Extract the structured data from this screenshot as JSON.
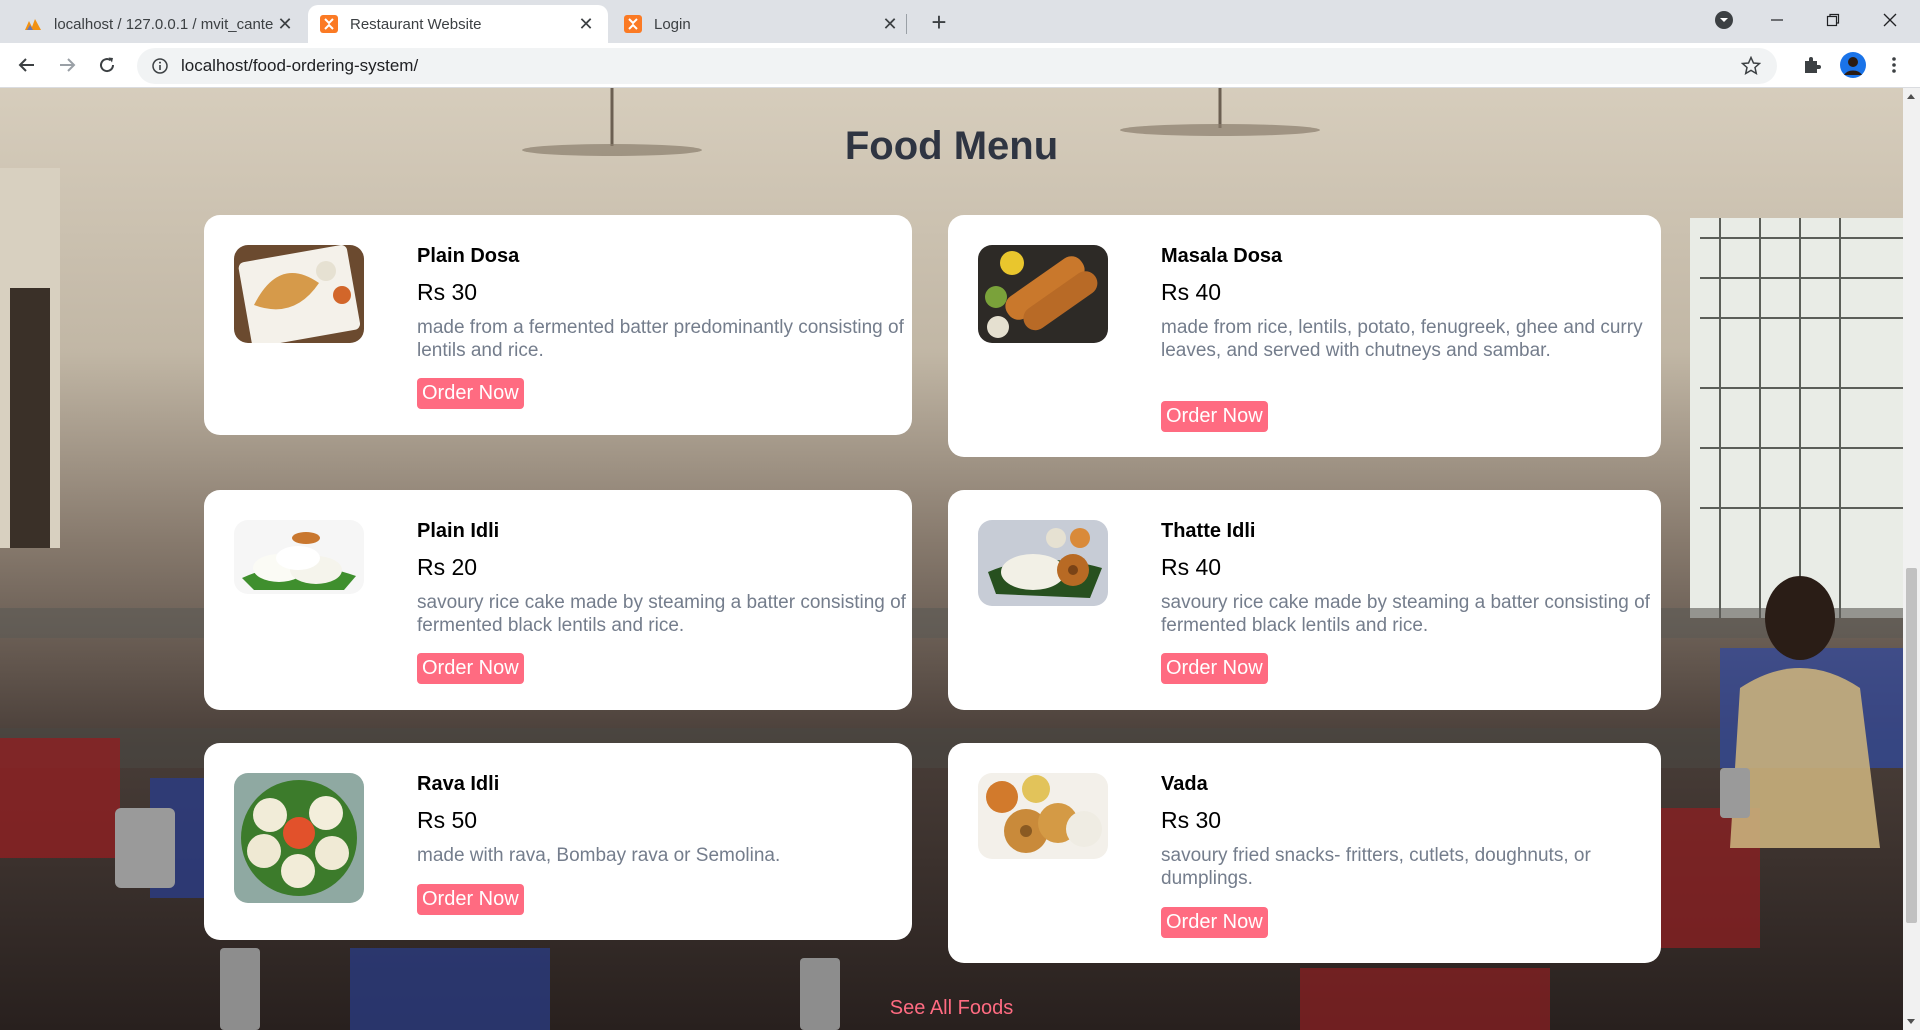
{
  "browser": {
    "tabs": [
      {
        "title": "localhost / 127.0.0.1 / mvit_cante",
        "favicon": "phpmyadmin-icon",
        "active": false
      },
      {
        "title": "Restaurant Website",
        "favicon": "xampp-icon",
        "active": true
      },
      {
        "title": "Login",
        "favicon": "xampp-icon",
        "active": false
      }
    ],
    "url": "localhost/food-ordering-system/"
  },
  "page": {
    "title": "Food Menu",
    "order_label": "Order Now",
    "see_all": "See All Foods",
    "foods": [
      {
        "name": "Plain Dosa",
        "price": "Rs 30",
        "description": "made from a fermented batter predominantly consisting of lentils and rice."
      },
      {
        "name": "Masala Dosa",
        "price": "Rs 40",
        "description": "made from rice, lentils, potato, fenugreek, ghee and curry leaves, and served with chutneys and sambar."
      },
      {
        "name": "Plain Idli",
        "price": "Rs 20",
        "description": "savoury rice cake made by steaming a batter consisting of fermented black lentils and rice."
      },
      {
        "name": "Thatte Idli",
        "price": "Rs 40",
        "description": "savoury rice cake made by steaming a batter consisting of fermented black lentils and rice."
      },
      {
        "name": "Rava Idli",
        "price": "Rs 50",
        "description": "made with rava, Bombay rava or Semolina."
      },
      {
        "name": "Vada",
        "price": "Rs 30",
        "description": "savoury fried snacks- fritters, cutlets, doughnuts, or dumplings."
      }
    ]
  },
  "colors": {
    "accent": "#ff6b81",
    "title": "#2f3542",
    "description": "#747d8c"
  }
}
